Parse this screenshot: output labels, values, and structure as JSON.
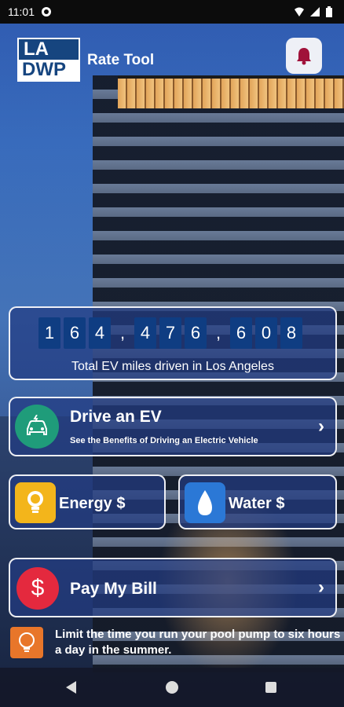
{
  "status_bar": {
    "time": "11:01"
  },
  "header": {
    "logo_line1": "LA",
    "logo_line2": "DWP",
    "title": "Rate Tool"
  },
  "odometer": {
    "digits": [
      "1",
      "6",
      "4",
      ",",
      "4",
      "7",
      "6",
      ",",
      "6",
      "0",
      "8"
    ],
    "caption": "Total EV miles driven in Los Angeles"
  },
  "drive_ev": {
    "title": "Drive an EV",
    "subtitle": "See the Benefits of Driving an Electric Vehicle"
  },
  "tiles": {
    "energy_label": "Energy $",
    "water_label": "Water $"
  },
  "pay_bill": {
    "icon_text": "$",
    "label": "Pay My Bill"
  },
  "tip": {
    "text": "Limit the time you run your pool pump to six hours a day in the summer."
  },
  "colors": {
    "card_border": "#ffffff",
    "digit_bg": "#0f3d82",
    "ev_green": "#1f9c7a",
    "energy_yellow": "#f3b51b",
    "water_blue": "#2b78d6",
    "pay_red": "#e4293e",
    "tip_orange": "#e8762a",
    "bell_color": "#a0123a"
  },
  "icons": {
    "bell": "bell-icon",
    "ev": "ev-car-icon",
    "energy": "lightbulb-icon",
    "water": "water-drop-icon",
    "tip": "lightbulb-tip-icon",
    "chevron": "chevron-right-icon"
  }
}
